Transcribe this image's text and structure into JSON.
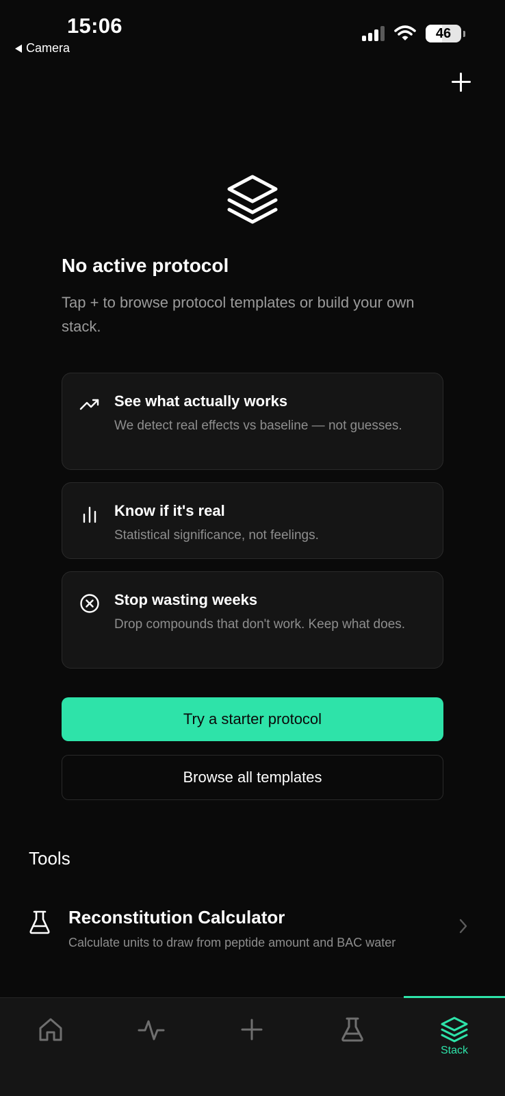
{
  "status_bar": {
    "time": "15:06",
    "back_label": "Camera",
    "battery_level": "46",
    "battery_fraction": 0.46,
    "signal_bars": 3
  },
  "header": {
    "add_icon": "plus-icon"
  },
  "empty_state": {
    "icon": "layers-stack-icon",
    "title": "No active protocol",
    "subtitle": "Tap + to browse protocol templates or build your own stack."
  },
  "features": [
    {
      "icon": "trending-up-icon",
      "title": "See what actually works",
      "description": "We detect real effects vs baseline — not guesses."
    },
    {
      "icon": "bar-chart-icon",
      "title": "Know if it's real",
      "description": "Statistical significance, not feelings."
    },
    {
      "icon": "x-circle-icon",
      "title": "Stop wasting weeks",
      "description": "Drop compounds that don't work. Keep what does."
    }
  ],
  "actions": {
    "primary_label": "Try a starter protocol",
    "secondary_label": "Browse all templates"
  },
  "tools": {
    "heading": "Tools",
    "items": [
      {
        "icon": "flask-icon",
        "title": "Reconstitution Calculator",
        "description": "Calculate units to draw from peptide amount and BAC water"
      }
    ]
  },
  "tabbar": {
    "tabs": [
      {
        "icon": "home-icon",
        "label": ""
      },
      {
        "icon": "activity-icon",
        "label": ""
      },
      {
        "icon": "plus-icon",
        "label": ""
      },
      {
        "icon": "flask-icon",
        "label": ""
      },
      {
        "icon": "layers-stack-icon",
        "label": "Stack"
      }
    ],
    "active_index": 4
  },
  "colors": {
    "accent": "#2ee3a9",
    "background": "#0a0a0a",
    "card": "#151515",
    "muted_text": "#8e8e8e"
  }
}
